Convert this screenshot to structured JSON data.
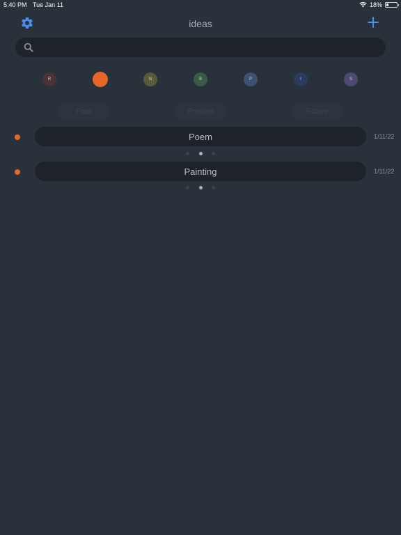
{
  "status_bar": {
    "time": "5:40 PM",
    "date": "Tue Jan 11",
    "battery": "18%",
    "battery_level": 0.18
  },
  "nav": {
    "title": "ideas",
    "settings_icon": "gear-icon",
    "add_icon": "plus-icon",
    "accent_color": "#4a8cf0"
  },
  "search": {
    "placeholder": "",
    "value": "",
    "icon": "search-icon"
  },
  "color_filters": [
    {
      "letter": "R",
      "color": "#4a3236",
      "selected": false
    },
    {
      "letter": "",
      "color": "#e7662a",
      "selected": true
    },
    {
      "letter": "N",
      "color": "#5a5a3a",
      "selected": false
    },
    {
      "letter": "B",
      "color": "#3a5a44",
      "selected": false
    },
    {
      "letter": "P",
      "color": "#3d5270",
      "selected": false
    },
    {
      "letter": "I",
      "color": "#2b3b5f",
      "selected": false
    },
    {
      "letter": "S",
      "color": "#4d4a72",
      "selected": false
    }
  ],
  "time_tabs": [
    {
      "label": "Past"
    },
    {
      "label": "Present"
    },
    {
      "label": "Future"
    }
  ],
  "ideas": [
    {
      "title": "Poem",
      "date": "1/11/22",
      "color": "#e7662a",
      "page_count": 3,
      "active_page": 1
    },
    {
      "title": "Painting",
      "date": "1/11/22",
      "color": "#e7662a",
      "page_count": 3,
      "active_page": 1
    }
  ]
}
